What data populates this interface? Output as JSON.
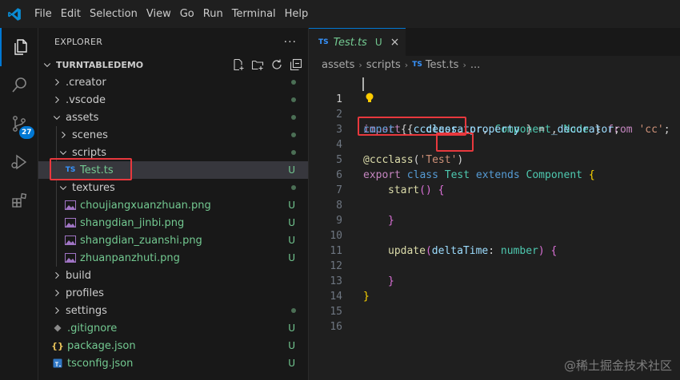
{
  "menubar": {
    "items": [
      "File",
      "Edit",
      "Selection",
      "View",
      "Go",
      "Run",
      "Terminal",
      "Help"
    ]
  },
  "activitybar": {
    "items": [
      "explorer-icon",
      "search-icon",
      "source-control-icon",
      "run-debug-icon",
      "extensions-icon"
    ],
    "scm_badge": "27",
    "accent": "#0078d4"
  },
  "sidebar": {
    "title": "EXPLORER",
    "more": "···",
    "section": "TURNTABLEDEMO",
    "tree": [
      {
        "label": ".creator",
        "status": "dot"
      },
      {
        "label": ".vscode",
        "status": "dot"
      },
      {
        "label": "assets",
        "status": "dot"
      },
      {
        "label": "scenes",
        "status": "dot"
      },
      {
        "label": "scripts",
        "status": "dot"
      },
      {
        "label": "Test.ts",
        "status": "U",
        "icon": "TS"
      },
      {
        "label": "textures",
        "status": "dot"
      },
      {
        "label": "choujiangxuanzhuan.png",
        "status": "U"
      },
      {
        "label": "shangdian_jinbi.png",
        "status": "U"
      },
      {
        "label": "shangdian_zuanshi.png",
        "status": "U"
      },
      {
        "label": "zhuanpanzhuti.png",
        "status": "U"
      },
      {
        "label": "build",
        "status": ""
      },
      {
        "label": "profiles",
        "status": ""
      },
      {
        "label": "settings",
        "status": "dot"
      },
      {
        "label": ".gitignore",
        "status": "U"
      },
      {
        "label": "package.json",
        "status": "U"
      },
      {
        "label": "tsconfig.json",
        "status": "U"
      }
    ]
  },
  "editor": {
    "tab": {
      "icon": "TS",
      "label": "Test.ts",
      "status": "U",
      "close": "×"
    },
    "breadcrumb": {
      "parts": [
        "assets",
        "scripts"
      ],
      "file_icon": "TS",
      "file": "Test.ts",
      "tail": "..."
    },
    "line_numbers": [
      "1",
      "2",
      "3",
      "4",
      "5",
      "6",
      "7",
      "8",
      "9",
      "10",
      "11",
      "12",
      "13",
      "14",
      "15",
      "16"
    ]
  },
  "code": {
    "l1": {
      "import": "import",
      "open": "{ ",
      "dec": "_decorator",
      "c1": ", ",
      "comp": "Component",
      "c2": ", ",
      "node": "Node",
      "close": " }",
      "from": "from",
      "mod": "'cc'",
      "semi": ";"
    },
    "l2": {
      "const": "const",
      "open": "{ ",
      "ccclass": "ccclass",
      "c1": ", ",
      "prop": "property",
      "close": " }",
      "eq": " = ",
      "dec": "_decorator",
      "semi": ";"
    },
    "l4": {
      "at": "@ccclass",
      "open": "(",
      "str": "'Test'",
      "close": ")"
    },
    "l5": {
      "export": "export",
      "class": "class",
      "name": "Test",
      "extends": "extends",
      "base": "Component",
      "brace": "{"
    },
    "l6": {
      "fn": "start",
      "parens": "()",
      "brace": "{"
    },
    "l8": {
      "brace": "}"
    },
    "l10": {
      "fn": "update",
      "open": "(",
      "param": "deltaTime",
      "colon": ": ",
      "type": "number",
      "close": ")",
      "brace": "{"
    },
    "l12": {
      "brace": "}"
    },
    "l13": {
      "brace": "}"
    }
  },
  "watermark": "@稀土掘金技术社区",
  "colors": {
    "highlight": "#e8383d",
    "untracked": "#73c991",
    "ts_blue": "#3794ff"
  }
}
